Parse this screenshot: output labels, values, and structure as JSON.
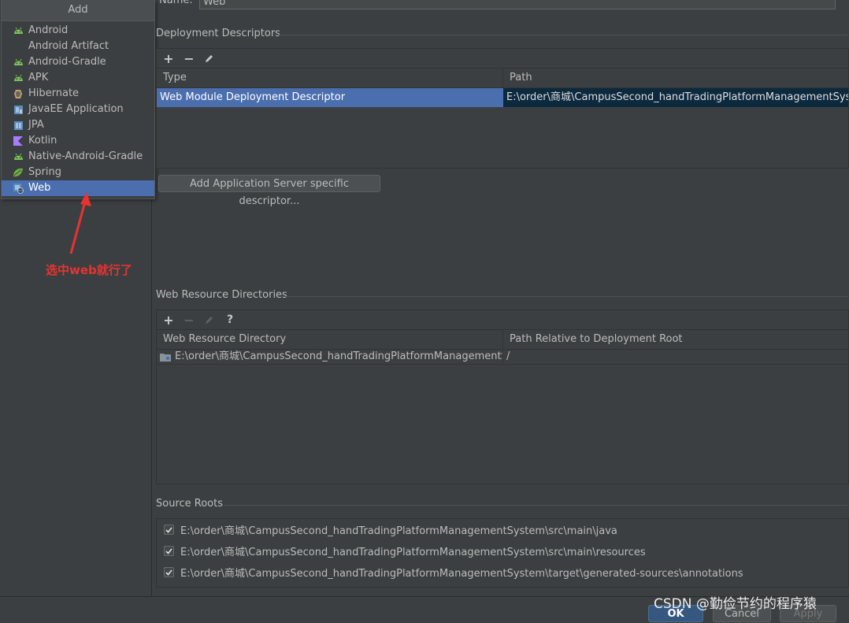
{
  "add_popup": {
    "title": "Add",
    "items": [
      {
        "label": "Android",
        "icon": "android-icon"
      },
      {
        "label": "Android Artifact",
        "icon": "none"
      },
      {
        "label": "Android-Gradle",
        "icon": "android-icon"
      },
      {
        "label": "APK",
        "icon": "android-icon"
      },
      {
        "label": "Hibernate",
        "icon": "hibernate-icon"
      },
      {
        "label": "JavaEE Application",
        "icon": "javaee-icon"
      },
      {
        "label": "JPA",
        "icon": "jpa-icon"
      },
      {
        "label": "Kotlin",
        "icon": "kotlin-icon"
      },
      {
        "label": "Native-Android-Gradle",
        "icon": "android-icon"
      },
      {
        "label": "Spring",
        "icon": "spring-icon"
      },
      {
        "label": "Web",
        "icon": "web-icon",
        "selected": true
      }
    ]
  },
  "annotation": "选中web就行了",
  "name": {
    "label": "Name:",
    "value": "Web"
  },
  "deployment_descriptors": {
    "title": "Deployment Descriptors",
    "columns": [
      "Type",
      "Path"
    ],
    "rows": [
      [
        "Web Module Deployment Descriptor",
        "E:\\order\\商城\\CampusSecond_handTradingPlatformManagementSystem\\s"
      ]
    ],
    "add_server_button": "Add Application Server specific descriptor..."
  },
  "web_resource_directories": {
    "title": "Web Resource Directories",
    "columns": [
      "Web Resource Directory",
      "Path Relative to Deployment Root"
    ],
    "rows": [
      [
        "E:\\order\\商城\\CampusSecond_handTradingPlatformManagementSyst...",
        "/"
      ]
    ]
  },
  "source_roots": {
    "title": "Source Roots",
    "items": [
      "E:\\order\\商城\\CampusSecond_handTradingPlatformManagementSystem\\src\\main\\java",
      "E:\\order\\商城\\CampusSecond_handTradingPlatformManagementSystem\\src\\main\\resources",
      "E:\\order\\商城\\CampusSecond_handTradingPlatformManagementSystem\\target\\generated-sources\\annotations"
    ]
  },
  "footer": {
    "ok": "OK",
    "cancel": "Cancel",
    "apply": "Apply"
  },
  "watermark": "CSDN @勤俭节约的程序猿",
  "colors": {
    "selection": "#4b6eaf",
    "annotation": "#e8332f",
    "android": "#78c257",
    "spring": "#6db33f",
    "kotlin": "#a97bff"
  }
}
